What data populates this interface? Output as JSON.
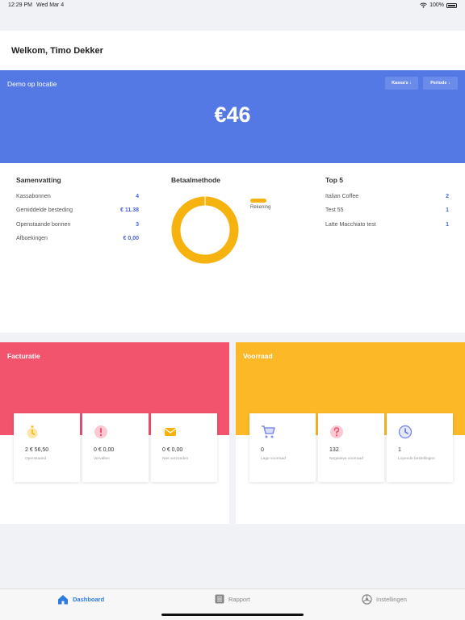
{
  "status": {
    "time": "12:29 PM",
    "date": "Wed Mar 4",
    "battery": "100%"
  },
  "welcome": "Welkom, Timo Dekker",
  "hero": {
    "location": "Demo op locatie",
    "btn_kassa": "Kassa's ↓",
    "btn_periode": "Periode ↓",
    "amount": "€46"
  },
  "summary": {
    "title": "Samenvatting",
    "rows": [
      {
        "label": "Kassabonnen",
        "value": "4"
      },
      {
        "label": "Gemiddelde besteding",
        "value": "€ 11.38"
      },
      {
        "label": "Openstaande bonnen",
        "value": "3"
      },
      {
        "label": "Afboekingen",
        "value": "€ 0,00"
      }
    ]
  },
  "payment": {
    "title": "Betaalmethode",
    "legend": "Rekening",
    "slices": [
      {
        "name": "Rekening",
        "share": 1.0,
        "color": "#f6b30f"
      }
    ]
  },
  "top5": {
    "title": "Top 5",
    "rows": [
      {
        "label": "Italian Coffee",
        "value": "2"
      },
      {
        "label": "Test 55",
        "value": "1"
      },
      {
        "label": "Latte Macchiato test",
        "value": "1"
      }
    ]
  },
  "facturatie": {
    "title": "Facturatie",
    "color": "#f2536d",
    "tiles": [
      {
        "icon": "stopwatch-icon",
        "value": "2 € 56,50",
        "label": "Openstaand"
      },
      {
        "icon": "alert-icon",
        "value": "0 € 0,00",
        "label": "Vervallen"
      },
      {
        "icon": "envelope-icon",
        "value": "0 € 0,00",
        "label": "Niet verzonden"
      }
    ]
  },
  "voorraad": {
    "title": "Voorraad",
    "color": "#fdb827",
    "tiles": [
      {
        "icon": "cart-icon",
        "value": "0",
        "label": "Lage voorraad"
      },
      {
        "icon": "question-icon",
        "value": "132",
        "label": "Negatieve voorraad"
      },
      {
        "icon": "clock-icon",
        "value": "1",
        "label": "Lopende bestellingen"
      }
    ]
  },
  "tabs": {
    "dashboard": "Dashboard",
    "rapport": "Rapport",
    "instellingen": "Instellingen"
  },
  "colors": {
    "accent": "#5579e4",
    "link": "#4a63d8",
    "tab_active": "#2f7ce0"
  }
}
